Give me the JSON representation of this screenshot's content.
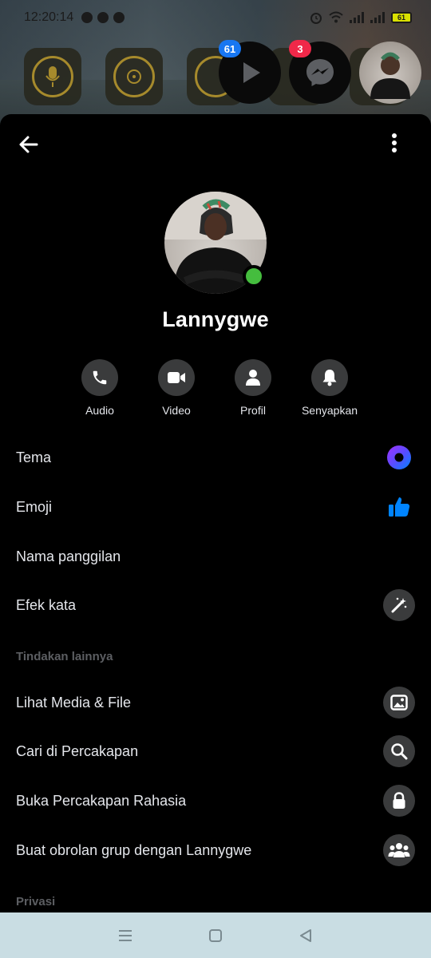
{
  "status_bar": {
    "time": "12:20:14",
    "battery": "61"
  },
  "bubbles": {
    "play_badge": "61",
    "messenger_badge": "3"
  },
  "profile": {
    "name": "Lannygwe"
  },
  "actions": [
    {
      "label": "Audio",
      "icon": "phone-icon"
    },
    {
      "label": "Video",
      "icon": "video-camera-icon"
    },
    {
      "label": "Profil",
      "icon": "person-icon"
    },
    {
      "label": "Senyapkan",
      "icon": "bell-icon"
    }
  ],
  "settings": [
    {
      "label": "Tema",
      "icon": "theme-icon"
    },
    {
      "label": "Emoji",
      "icon": "thumbs-up-icon"
    },
    {
      "label": "Nama panggilan",
      "icon": ""
    },
    {
      "label": "Efek kata",
      "icon": "magic-wand-icon"
    }
  ],
  "more_actions": {
    "title": "Tindakan lainnya",
    "items": [
      {
        "label": "Lihat Media & File",
        "icon": "image-icon"
      },
      {
        "label": "Cari di Percakapan",
        "icon": "search-icon"
      },
      {
        "label": "Buka Percakapan Rahasia",
        "icon": "lock-icon"
      },
      {
        "label": "Buat obrolan grup dengan Lannygwe",
        "icon": "group-icon"
      }
    ]
  },
  "privacy": {
    "title": "Privasi"
  },
  "colors": {
    "accent": "#0084ff",
    "online": "#45bd3e",
    "badge_blue": "#1877f2",
    "badge_red": "#f02849"
  }
}
